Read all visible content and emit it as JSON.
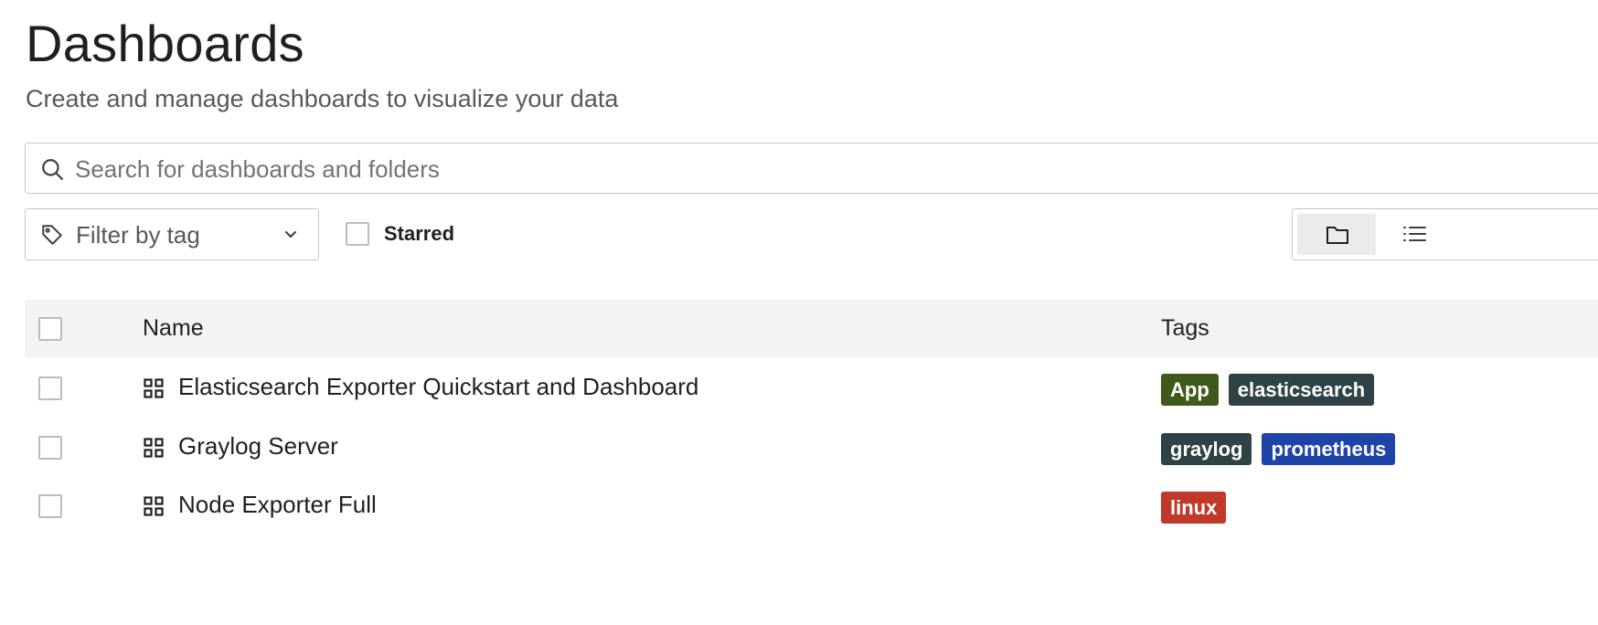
{
  "page": {
    "title": "Dashboards",
    "subtitle": "Create and manage dashboards to visualize your data"
  },
  "search": {
    "placeholder": "Search for dashboards and folders",
    "icon": "search-icon"
  },
  "filters": {
    "tag_filter_label": "Filter by tag",
    "starred_label": "Starred",
    "starred_checked": false
  },
  "view_toggle": {
    "selected": "folder",
    "options": [
      "folder-view",
      "list-view"
    ]
  },
  "table": {
    "headers": {
      "name": "Name",
      "tags": "Tags"
    },
    "rows": [
      {
        "name": "Elasticsearch Exporter Quickstart and Dashboard",
        "tags": [
          {
            "label": "App",
            "color": "#3f5a1b"
          },
          {
            "label": "elasticsearch",
            "color": "#2f4246"
          }
        ]
      },
      {
        "name": "Graylog Server",
        "tags": [
          {
            "label": "graylog",
            "color": "#2f4246"
          },
          {
            "label": "prometheus",
            "color": "#1f44a8"
          }
        ]
      },
      {
        "name": "Node Exporter Full",
        "tags": [
          {
            "label": "linux",
            "color": "#c0392b"
          }
        ]
      }
    ]
  }
}
